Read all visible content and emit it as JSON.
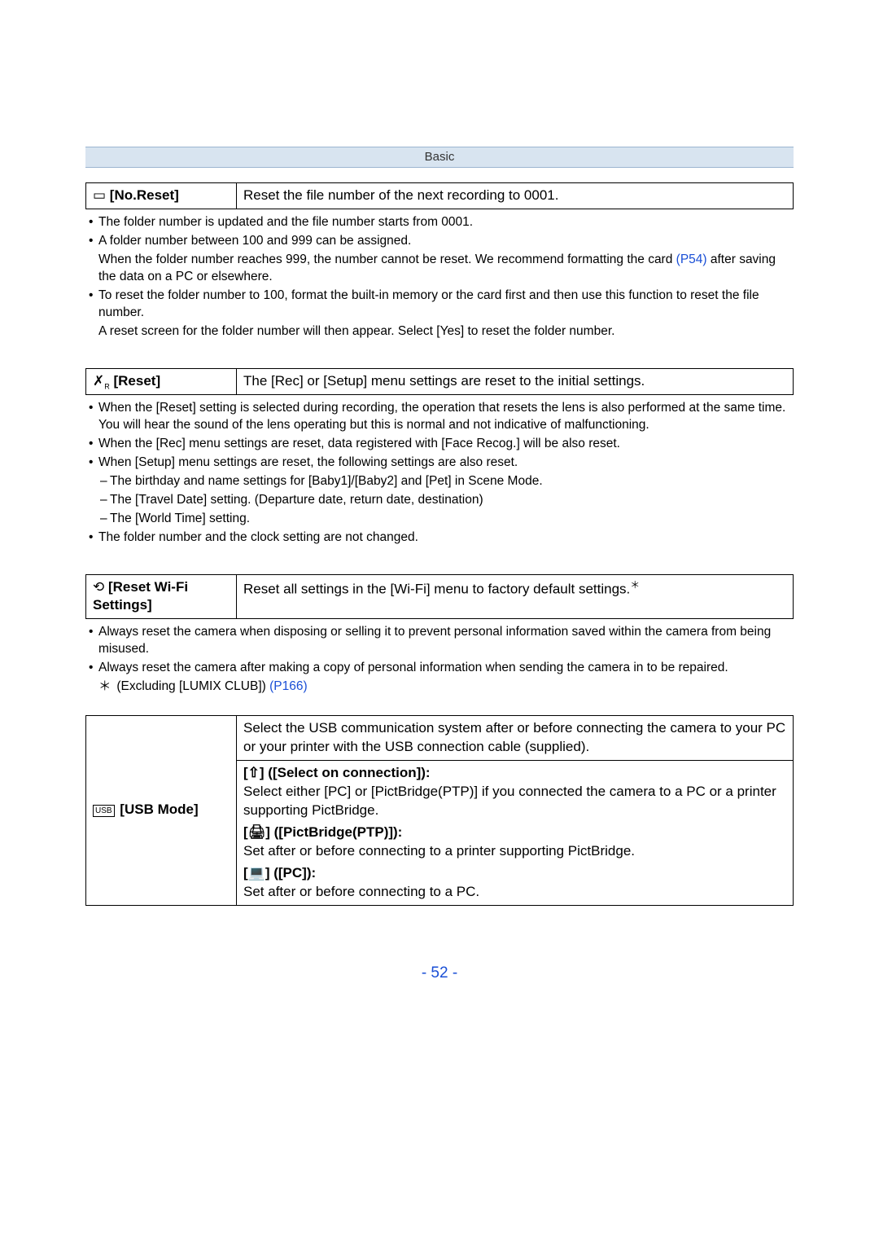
{
  "header": {
    "section": "Basic"
  },
  "no_reset": {
    "label": "[No.Reset]",
    "desc": "Reset the file number of the next recording to 0001.",
    "n1": "The folder number is updated and the file number starts from 0001.",
    "n2": "A folder number between 100 and 999 can be assigned.",
    "n2b_a": "When the folder number reaches 999, the number cannot be reset. We recommend formatting the card ",
    "n2b_link": "(P54)",
    "n2b_c": " after saving the data on a PC or elsewhere.",
    "n3": "To reset the folder number to 100, format the built-in memory or the card first and then use this function to reset the file number.",
    "n3b": "A reset screen for the folder number will then appear. Select [Yes] to reset the folder number."
  },
  "reset": {
    "label": "[Reset]",
    "desc": "The [Rec] or [Setup] menu settings are reset to the initial settings.",
    "n1": "When the [Reset] setting is selected during recording, the operation that resets the lens is also performed at the same time. You will hear the sound of the lens operating but this is normal and not indicative of malfunctioning.",
    "n2": "When the [Rec] menu settings are reset, data registered with [Face Recog.] will be also reset.",
    "n3": "When [Setup] menu settings are reset, the following settings are also reset.",
    "s1": "The birthday and name settings for [Baby1]/[Baby2] and [Pet] in Scene Mode.",
    "s2": "The [Travel Date] setting. (Departure date, return date, destination)",
    "s3": "The [World Time] setting.",
    "n4": "The folder number and the clock setting are not changed."
  },
  "wifi": {
    "label": "[Reset Wi-Fi Settings]",
    "desc_a": "Reset all settings in the [Wi-Fi] menu to factory default settings.",
    "n1": "Always reset the camera when disposing or selling it to prevent personal information saved within the camera from being misused.",
    "n2": "Always reset the camera after making a copy of personal information when sending the camera in to be repaired.",
    "foot_a": "(Excluding [LUMIX CLUB]) ",
    "foot_link": "(P166)"
  },
  "usb": {
    "label": "[USB Mode]",
    "row1": "Select the USB communication system after or before connecting the camera to your PC or your printer with the USB connection cable (supplied).",
    "opt1_label": " ([Select on connection]):",
    "opt1_body": "Select either [PC] or [PictBridge(PTP)] if you connected the camera to a PC or a printer supporting PictBridge.",
    "opt2_label": " ([PictBridge(PTP)]):",
    "opt2_body": "Set after or before connecting to a printer supporting PictBridge.",
    "opt3_label": " ([PC]):",
    "opt3_body": "Set after or before connecting to a PC."
  },
  "page_number": "- 52 -"
}
